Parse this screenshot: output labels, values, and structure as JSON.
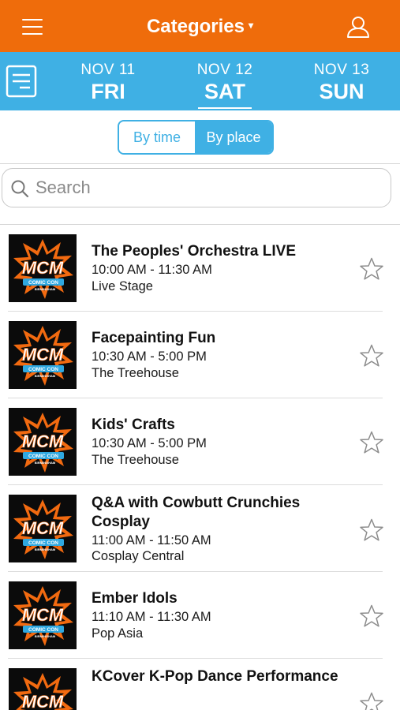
{
  "header": {
    "title": "Categories",
    "caret": "▾",
    "menu_icon": "hamburger-menu-icon",
    "profile_icon": "user-profile-icon",
    "color": "#ef6c0b"
  },
  "dates": {
    "color": "#3fb0e4",
    "schedule_icon": "schedule-list-icon",
    "days": [
      {
        "date": "NOV 11",
        "weekday": "FRI",
        "selected": false
      },
      {
        "date": "NOV 12",
        "weekday": "SAT",
        "selected": true
      },
      {
        "date": "NOV 13",
        "weekday": "SUN",
        "selected": false
      }
    ]
  },
  "view_toggle": {
    "by_time": "By time",
    "by_place": "By place",
    "selected": "By time"
  },
  "search": {
    "placeholder": "Search",
    "value": ""
  },
  "events": [
    {
      "title": "The Peoples' Orchestra LIVE",
      "time": "10:00 AM - 11:30 AM",
      "place": "Live Stage"
    },
    {
      "title": "Facepainting Fun",
      "time": "10:30 AM - 5:00 PM",
      "place": "The Treehouse"
    },
    {
      "title": "Kids' Crafts",
      "time": "10:30 AM - 5:00 PM",
      "place": "The Treehouse"
    },
    {
      "title": "Q&A with Cowbutt Crunchies Cosplay",
      "time": "11:00 AM - 11:50 AM",
      "place": "Cosplay Central"
    },
    {
      "title": "Ember Idols",
      "time": "11:10 AM - 11:30 AM",
      "place": "Pop Asia"
    },
    {
      "title": "KCover K-Pop Dance Performance",
      "time": "",
      "place": ""
    }
  ],
  "event_logo": {
    "big": "MCM",
    "band": "COMIC CON",
    "small": "BIRMINGHAM"
  }
}
